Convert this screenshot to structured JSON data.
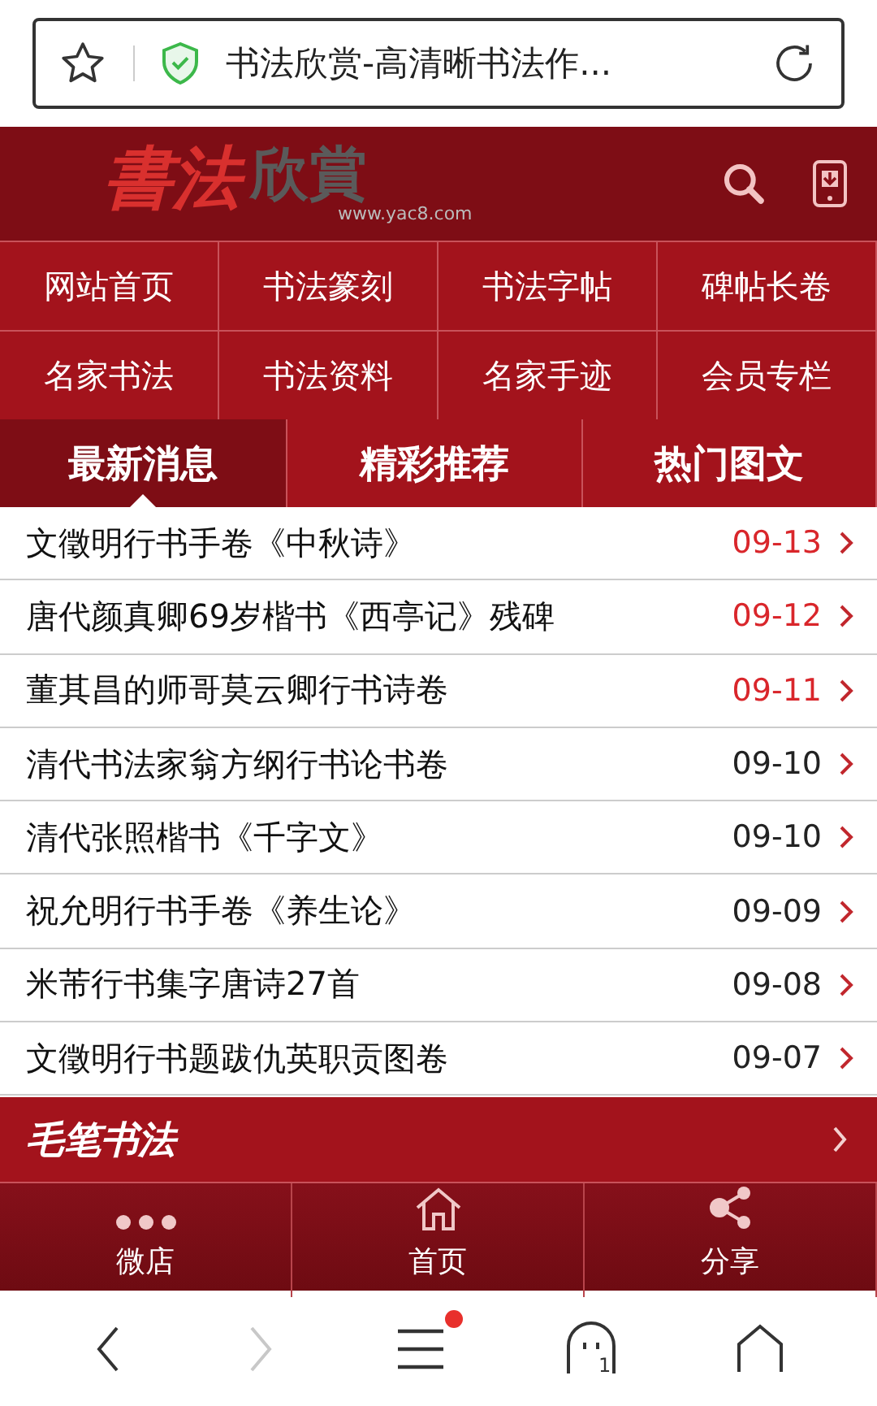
{
  "address_bar": {
    "title": "书法欣赏-高清晰书法作..."
  },
  "header": {
    "logo_main": "書法",
    "logo_second": "欣賞",
    "logo_url": "www.yac8.com"
  },
  "nav": [
    "网站首页",
    "书法篆刻",
    "书法字帖",
    "碑帖长卷",
    "名家书法",
    "书法资料",
    "名家手迹",
    "会员专栏"
  ],
  "tabs": [
    {
      "label": "最新消息",
      "selected": true
    },
    {
      "label": "精彩推荐",
      "selected": false
    },
    {
      "label": "热门图文",
      "selected": false
    }
  ],
  "articles": [
    {
      "title": "文徵明行书手卷《中秋诗》",
      "date": "09-13",
      "recent": true
    },
    {
      "title": "唐代颜真卿69岁楷书《西亭记》残碑",
      "date": "09-12",
      "recent": true
    },
    {
      "title": "董其昌的师哥莫云卿行书诗卷",
      "date": "09-11",
      "recent": true
    },
    {
      "title": "清代书法家翁方纲行书论书卷",
      "date": "09-10",
      "recent": false
    },
    {
      "title": "清代张照楷书《千字文》",
      "date": "09-10",
      "recent": false
    },
    {
      "title": "祝允明行书手卷《养生论》",
      "date": "09-09",
      "recent": false
    },
    {
      "title": "米芾行书集字唐诗27首",
      "date": "09-08",
      "recent": false
    },
    {
      "title": "文徵明行书题跋仇英职贡图卷",
      "date": "09-07",
      "recent": false
    }
  ],
  "section": {
    "title": "毛笔书法"
  },
  "footer": [
    {
      "kind": "dots",
      "label": "微店"
    },
    {
      "kind": "home",
      "label": "首页"
    },
    {
      "kind": "share",
      "label": "分享"
    }
  ],
  "browser_nav": {
    "forward_disabled": true,
    "menu_badge": true,
    "tab_count": "1"
  }
}
